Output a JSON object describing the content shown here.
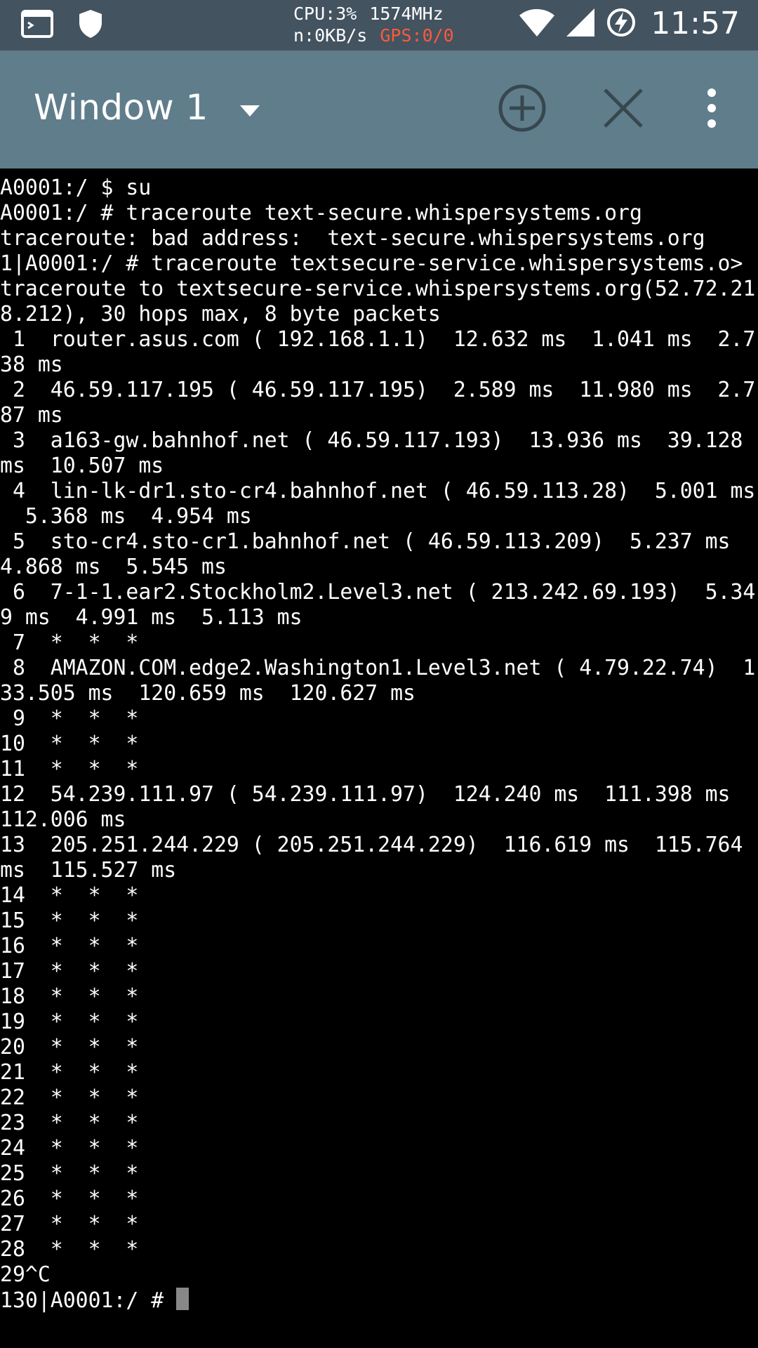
{
  "status_bar": {
    "cpu": "CPU:3%",
    "freq": "1574MHz",
    "net": "n:0KB/s",
    "gps": "GPS:0/0",
    "time": "11:57",
    "icons": [
      "terminal-notification-icon",
      "shield-icon",
      "wifi-icon",
      "cell-signal-icon",
      "battery-charging-icon"
    ],
    "gps_color": "#ff5a3a"
  },
  "toolbar": {
    "window_title": "Window 1",
    "icons": [
      "dropdown-arrow-icon",
      "add-window-icon",
      "close-window-icon",
      "overflow-menu-icon"
    ],
    "color": "#607d8b"
  },
  "terminal": {
    "lines": [
      "A0001:/ $ su",
      "A0001:/ # traceroute text-secure.whispersystems.org",
      "traceroute: bad address:  text-secure.whispersystems.org",
      "1|A0001:/ # traceroute textsecure-service.whispersystems.o>",
      "traceroute to textsecure-service.whispersystems.org(52.72.21",
      "8.212), 30 hops max, 8 byte packets",
      " 1  router.asus.com ( 192.168.1.1)  12.632 ms  1.041 ms  2.7",
      "38 ms",
      " 2  46.59.117.195 ( 46.59.117.195)  2.589 ms  11.980 ms  2.7",
      "87 ms",
      " 3  a163-gw.bahnhof.net ( 46.59.117.193)  13.936 ms  39.128",
      "ms  10.507 ms",
      " 4  lin-lk-dr1.sto-cr4.bahnhof.net ( 46.59.113.28)  5.001 ms",
      "  5.368 ms  4.954 ms",
      " 5  sto-cr4.sto-cr1.bahnhof.net ( 46.59.113.209)  5.237 ms",
      "4.868 ms  5.545 ms",
      " 6  7-1-1.ear2.Stockholm2.Level3.net ( 213.242.69.193)  5.34",
      "9 ms  4.991 ms  5.113 ms",
      " 7  *  *  *",
      " 8  AMAZON.COM.edge2.Washington1.Level3.net ( 4.79.22.74)  1",
      "33.505 ms  120.659 ms  120.627 ms",
      " 9  *  *  *",
      "10  *  *  *",
      "11  *  *  *",
      "12  54.239.111.97 ( 54.239.111.97)  124.240 ms  111.398 ms",
      "112.006 ms",
      "13  205.251.244.229 ( 205.251.244.229)  116.619 ms  115.764",
      "ms  115.527 ms",
      "14  *  *  *",
      "15  *  *  *",
      "16  *  *  *",
      "17  *  *  *",
      "18  *  *  *",
      "19  *  *  *",
      "20  *  *  *",
      "21  *  *  *",
      "22  *  *  *",
      "23  *  *  *",
      "24  *  *  *",
      "25  *  *  *",
      "26  *  *  *",
      "27  *  *  *",
      "28  *  *  *",
      "29^C"
    ],
    "prompt": "130|A0001:/ # "
  }
}
